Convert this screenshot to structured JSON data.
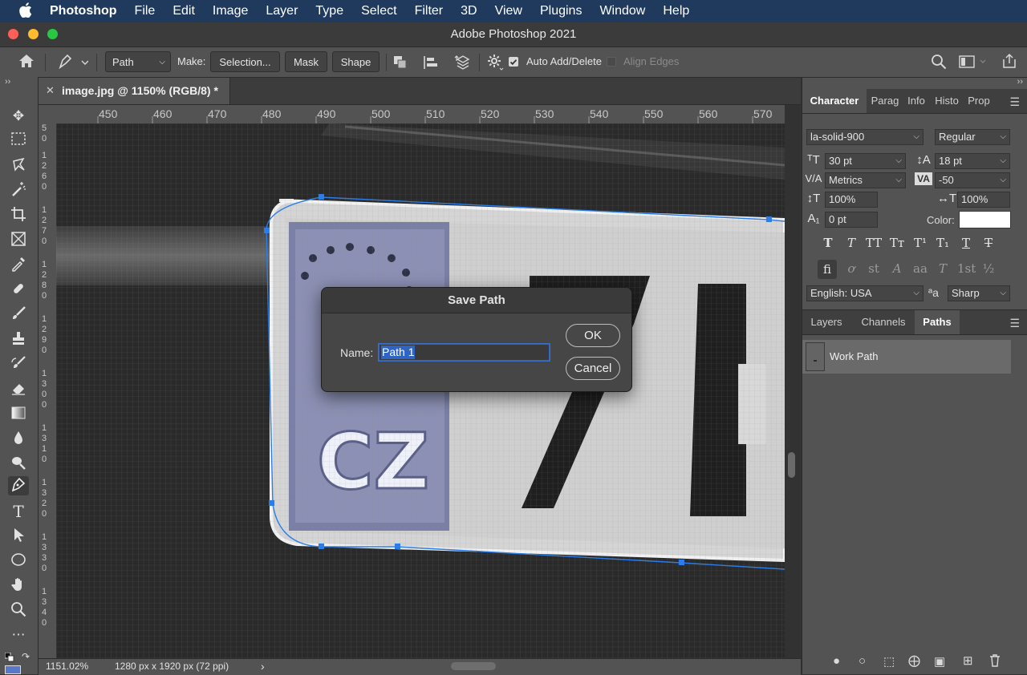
{
  "menubar": {
    "apple_icon": "apple-icon",
    "items": [
      "Photoshop",
      "File",
      "Edit",
      "Image",
      "Layer",
      "Type",
      "Select",
      "Filter",
      "3D",
      "View",
      "Plugins",
      "Window",
      "Help"
    ]
  },
  "window": {
    "title": "Adobe Photoshop 2021"
  },
  "options": {
    "mode": "Path",
    "make_label": "Make:",
    "selection": "Selection...",
    "mask": "Mask",
    "shape": "Shape",
    "auto_add_delete": "Auto Add/Delete",
    "auto_add_delete_checked": true,
    "align_edges": "Align Edges",
    "align_edges_checked": false
  },
  "document": {
    "tab_title": "image.jpg @ 1150% (RGB/8) *",
    "ruler_h": [
      "450",
      "460",
      "470",
      "480",
      "490",
      "500",
      "510",
      "520",
      "530",
      "540",
      "550",
      "560",
      "570"
    ],
    "ruler_v": [
      "5 0",
      "1 2 6 0",
      "1 2 7 0",
      "1 2 8 0",
      "1 2 9 0",
      "1 3 0 0",
      "1 3 1 0",
      "1 3 2 0",
      "1 3 3 0",
      "1 3 4 0"
    ],
    "zoom": "1151.02%",
    "doc_size": "1280 px x 1920 px (72 ppi)"
  },
  "dialog": {
    "title": "Save Path",
    "name_label": "Name:",
    "name_value": "Path 1",
    "ok": "OK",
    "cancel": "Cancel"
  },
  "character_panel": {
    "tabs": [
      "Character",
      "Parag",
      "Info",
      "Histo",
      "Prop"
    ],
    "font_family": "la-solid-900",
    "font_style": "Regular",
    "font_size": "30 pt",
    "leading": "18 pt",
    "kerning": "Metrics",
    "tracking": "-50",
    "vertical_scale": "100%",
    "horizontal_scale": "100%",
    "baseline_shift": "0 pt",
    "color_label": "Color:",
    "text_color": "#ffffff",
    "style_glyphs": [
      "T",
      "T",
      "TT",
      "Tт",
      "T¹",
      "T₁",
      "T",
      "T"
    ],
    "opentype_glyphs": [
      "fi",
      "ơ",
      "st",
      "A",
      "aa",
      "T",
      "1st",
      "½"
    ],
    "language": "English: USA",
    "aa_symbol": "ªa",
    "antialias": "Sharp"
  },
  "paths_panel": {
    "tabs": [
      "Layers",
      "Channels",
      "Paths"
    ],
    "items": [
      "Work Path"
    ]
  },
  "colors": {
    "menubar": "#203a5e",
    "path": "#2b7de9",
    "selection": "#2f64c4"
  }
}
